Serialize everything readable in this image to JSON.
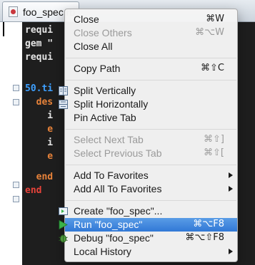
{
  "tab": {
    "label": "foo_spec.rb"
  },
  "code": {
    "lines": [
      "requi",
      "gem \"",
      "requi",
      "",
      "50.ti",
      "  des",
      "    i",
      "    e",
      "    i",
      "    e",
      "  end",
      "end"
    ]
  },
  "menu": {
    "items": [
      {
        "label": "Close",
        "shortcut": "⌘W",
        "state": "enabled"
      },
      {
        "label": "Close Others",
        "shortcut": "⌘⌥W",
        "state": "disabled"
      },
      {
        "label": "Close All",
        "shortcut": "",
        "state": "enabled"
      },
      {
        "label": "Copy Path",
        "shortcut": "⌘⇧C",
        "state": "enabled"
      },
      {
        "label": "Split Vertically",
        "shortcut": "",
        "state": "enabled",
        "icon": "split-vertical-icon"
      },
      {
        "label": "Split Horizontally",
        "shortcut": "",
        "state": "enabled",
        "icon": "split-horizontal-icon"
      },
      {
        "label": "Pin Active Tab",
        "shortcut": "",
        "state": "enabled"
      },
      {
        "label": "Select Next Tab",
        "shortcut": "⌘⇧]",
        "state": "disabled"
      },
      {
        "label": "Select Previous Tab",
        "shortcut": "⌘⇧[",
        "state": "disabled"
      },
      {
        "label": "Add To Favorites",
        "shortcut": "",
        "state": "enabled",
        "submenu": true
      },
      {
        "label": "Add All To Favorites",
        "shortcut": "",
        "state": "enabled",
        "submenu": true
      },
      {
        "label": "Create  \"foo_spec\"...",
        "shortcut": "",
        "state": "enabled",
        "icon": "rspec-config-icon"
      },
      {
        "label": "Run \"foo_spec\"",
        "shortcut": "⌘⌥F8",
        "state": "selected",
        "icon": "run-icon"
      },
      {
        "label": "Debug \"foo_spec\"",
        "shortcut": "⌘⌥⇧F8",
        "state": "enabled",
        "icon": "debug-icon"
      },
      {
        "label": "Local History",
        "shortcut": "",
        "state": "enabled",
        "submenu": true
      }
    ]
  },
  "colors": {
    "selection": "#3178d6",
    "disabled_text": "#9a9a9a",
    "run_icon": "#3bb34a",
    "code_bg": "#1e1e1e"
  }
}
